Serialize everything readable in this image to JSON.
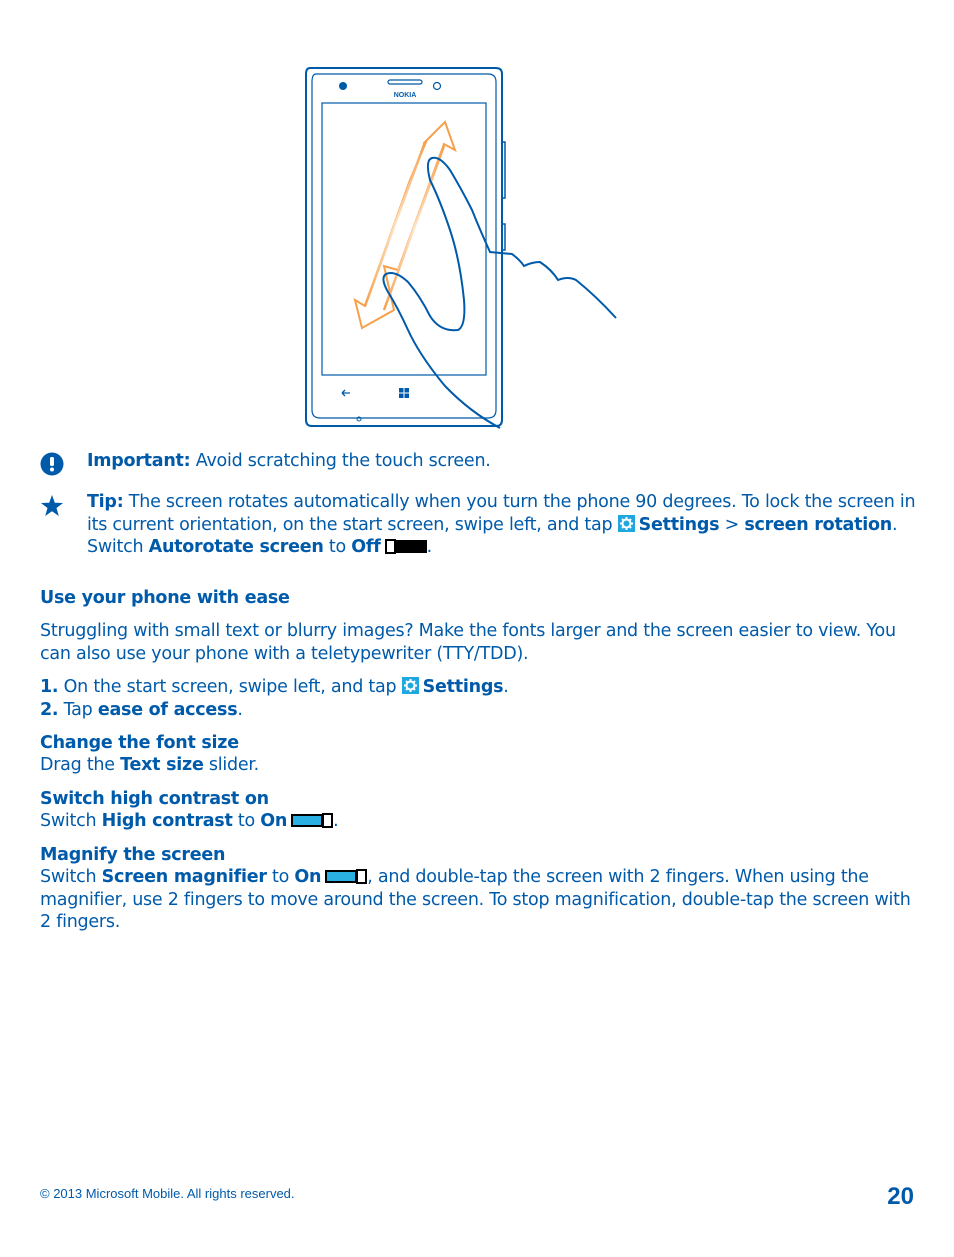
{
  "illustration": {
    "description": "Phone with two-finger pinch/stretch gesture",
    "brand": "NOKIA"
  },
  "notes": {
    "important": {
      "icon": "exclamation-icon",
      "label": "Important:",
      "text": " Avoid scratching the touch screen."
    },
    "tip": {
      "icon": "star-icon",
      "label": "Tip:",
      "text1": " The screen rotates automatically when you turn the phone 90 degrees. To lock the screen in its current orientation, on the start screen, swipe left, and tap ",
      "settings": "Settings",
      "sep": " > ",
      "screen_rotation": "screen rotation",
      "text2": ". Switch ",
      "autorotate": "Autorotate screen",
      "to": " to ",
      "off": "Off",
      "end": "."
    }
  },
  "section": {
    "title": "Use your phone with ease",
    "intro": "Struggling with small text or blurry images? Make the fonts larger and the screen easier to view. You can also use your phone with a teletypewriter (TTY/TDD).",
    "steps": [
      {
        "num": "1.",
        "pre": " On the start screen, swipe left, and tap ",
        "bold": "Settings",
        "post": "."
      },
      {
        "num": "2.",
        "pre": " Tap ",
        "bold": "ease of access",
        "post": "."
      }
    ],
    "subsections": {
      "font": {
        "title": "Change the font size",
        "pre": "Drag the ",
        "bold": "Text size",
        "post": " slider."
      },
      "contrast": {
        "title": "Switch high contrast on",
        "pre": "Switch ",
        "bold": "High contrast",
        "to": " to ",
        "on": "On",
        "post": "."
      },
      "magnify": {
        "title": "Magnify the screen",
        "pre": "Switch ",
        "bold": "Screen magnifier",
        "to": " to ",
        "on": "On",
        "post": ", and double-tap the screen with 2 fingers. When using the magnifier, use 2 fingers to move around the screen. To stop magnification, double-tap the screen with 2 fingers."
      }
    }
  },
  "footer": {
    "copyright": "© 2013 Microsoft Mobile. All rights reserved.",
    "page_number": "20"
  },
  "colors": {
    "text": "#005aaa",
    "settings_icon": "#1fa8e0",
    "toggle_on": "#2bb0e4",
    "arrow": "#f7a04a"
  }
}
